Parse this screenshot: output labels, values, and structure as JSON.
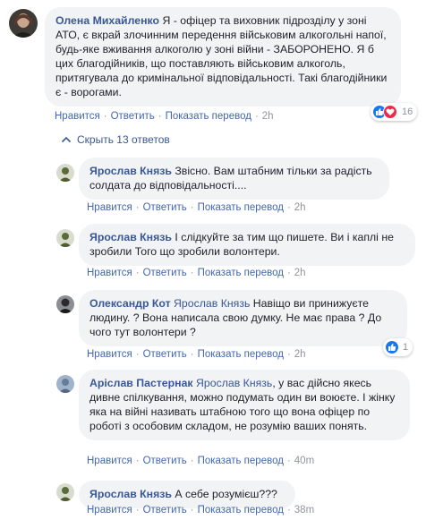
{
  "colors": {
    "link": "#385898",
    "action": "#4267b2",
    "muted": "#90949c",
    "bubble": "#f2f3f5"
  },
  "main_comment": {
    "author": "Олена Михайленко",
    "text": " Я - офіцер та виховник підрозділу у зоні АТО, є вкрай злочинним передення військовим алкогольні напої, будь-яке вживання алкоголю у зоні війни - ЗАБОРОНЕНО. Я б цих благодійників, що поставляють військовим алкоголь, притягувала до кримінальної відповідальності. Такі благодійники є - ворогами.",
    "reactions": {
      "icons": [
        "like-icon",
        "love-icon"
      ],
      "count": "16"
    },
    "actions": {
      "like": "Нравится",
      "reply": "Ответить",
      "translate": "Показать перевод",
      "time": "2h"
    }
  },
  "collapse_label": "Скрыть 13 ответов",
  "replies": [
    {
      "author": "Ярослав Князь",
      "mention": "",
      "text": " Звісно. Вам штабним тільки за радість солдата до відповідальності....",
      "actions": {
        "like": "Нравится",
        "reply": "Ответить",
        "translate": "Показать перевод",
        "time": "2h"
      }
    },
    {
      "author": "Ярослав Князь",
      "mention": "",
      "text": " І слідкуйте за тим що пишете. Ви і каплі не зробили Того що зробили волонтери.",
      "actions": {
        "like": "Нравится",
        "reply": "Ответить",
        "translate": "Показать перевод",
        "time": "2h"
      }
    },
    {
      "author": "Олександр Кот",
      "mention": "Ярослав Князь",
      "text": " Навіщо ви принижуєте людину. ? Вона написала свою думку. Не має права ? До чого тут волонтери ?",
      "reactions": {
        "icons": [
          "like-icon"
        ],
        "count": "1"
      },
      "actions": {
        "like": "Нравится",
        "reply": "Ответить",
        "translate": "Показать перевод",
        "time": "2h"
      }
    },
    {
      "author": "Аріслав Пастернак",
      "mention": "Ярослав Князь",
      "text": ", у вас дійсно якесь дивне спілкування, можно подумать один ви воюєте. І жінку яка на війні називать штабною того що вона офіцер по роботі з особовим складом, не розумію ваших понять.",
      "actions": {
        "like": "Нравится",
        "reply": "Ответить",
        "translate": "Показать перевод",
        "time": "40m"
      }
    },
    {
      "author": "Ярослав Князь",
      "mention": "",
      "text": " А себе розумієш???",
      "actions": {
        "like": "Нравится",
        "reply": "Ответить",
        "translate": "Показать перевод",
        "time": "38m"
      }
    }
  ]
}
